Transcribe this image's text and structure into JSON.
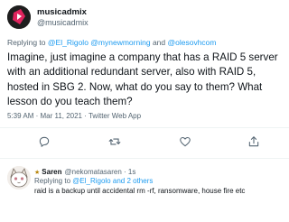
{
  "tweet": {
    "display_name": "musicadmix",
    "handle": "@musicadmix",
    "replying_prefix": "Replying to",
    "replying_to": [
      "@El_Rigolo",
      "@mynewmorning",
      "@olesovhcom"
    ],
    "replying_and": "and",
    "text": "Imagine, just imagine a company that has a RAID 5 server with an additional redundant server, also with RAID 5, hosted in SBG 2. Now, what do you say to them? What lesson do you teach them?",
    "timestamp": "5:39 AM · Mar 11, 2021 · Twitter Web App"
  },
  "actions": {
    "icons": [
      "reply-icon",
      "retweet-icon",
      "like-icon",
      "share-icon"
    ]
  },
  "reply": {
    "emoji": "★",
    "display_name": "Saren",
    "handle_time": "@nekomatasaren · 1s",
    "replying_prefix": "Replying to",
    "replying_to": "@El_Rigolo",
    "replying_suffix": "and 2 others",
    "text": "raid is a backup until accidental rm -rf, ransomware, house fire etc"
  },
  "colors": {
    "link": "#1d9bf0",
    "secondary_text": "#536471",
    "brand_avatar": "#e0245e"
  }
}
